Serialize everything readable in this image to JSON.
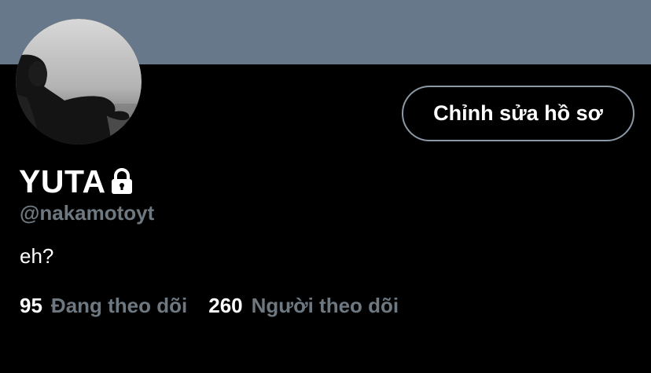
{
  "profile": {
    "display_name": "YUTA",
    "handle": "@nakamotoyt",
    "bio": "eh?",
    "locked_icon": "lock-icon",
    "edit_button_label": "Chỉnh sửa hồ sơ",
    "following_count": "95",
    "following_label": "Đang theo dõi",
    "followers_count": "260",
    "followers_label": "Người theo dõi"
  },
  "colors": {
    "banner": "#66788a",
    "background": "#000000",
    "muted_text": "#6e7881",
    "button_border": "#8b98a5"
  }
}
